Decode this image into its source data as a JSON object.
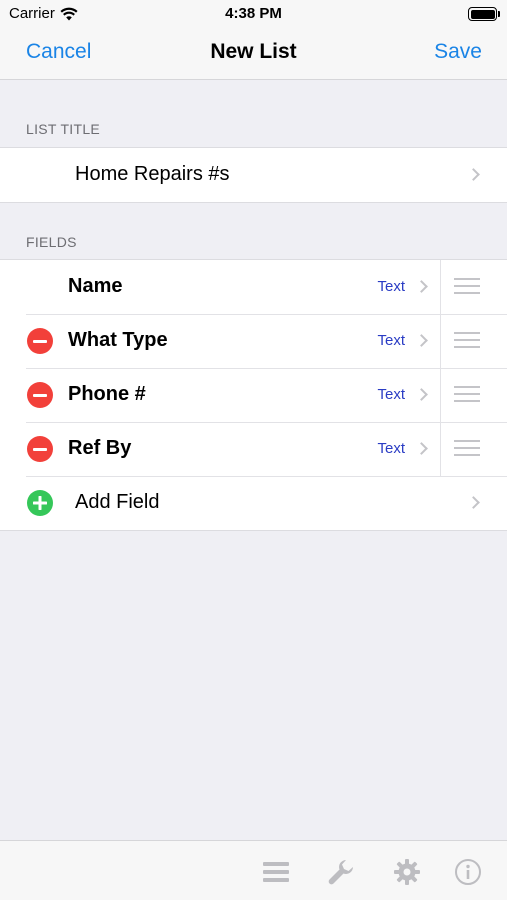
{
  "status_bar": {
    "carrier": "Carrier",
    "time": "4:38 PM"
  },
  "nav": {
    "cancel": "Cancel",
    "title": "New List",
    "save": "Save"
  },
  "list_title_section": {
    "header": "LIST TITLE",
    "value": "Home Repairs #s"
  },
  "fields_section": {
    "header": "FIELDS",
    "fields": [
      {
        "name": "Name",
        "type": "Text",
        "deletable": false
      },
      {
        "name": "What Type",
        "type": "Text",
        "deletable": true
      },
      {
        "name": "Phone #",
        "type": "Text",
        "deletable": true
      },
      {
        "name": "Ref By",
        "type": "Text",
        "deletable": true
      }
    ],
    "add_label": "Add Field"
  },
  "toolbar": {
    "icons": [
      "list-icon",
      "wrench-icon",
      "gear-icon",
      "info-icon"
    ]
  },
  "colors": {
    "accent": "#1a84e6",
    "delete": "#f2403a",
    "add": "#35c759",
    "type_label": "#2a3cc4",
    "background": "#efeff4"
  }
}
